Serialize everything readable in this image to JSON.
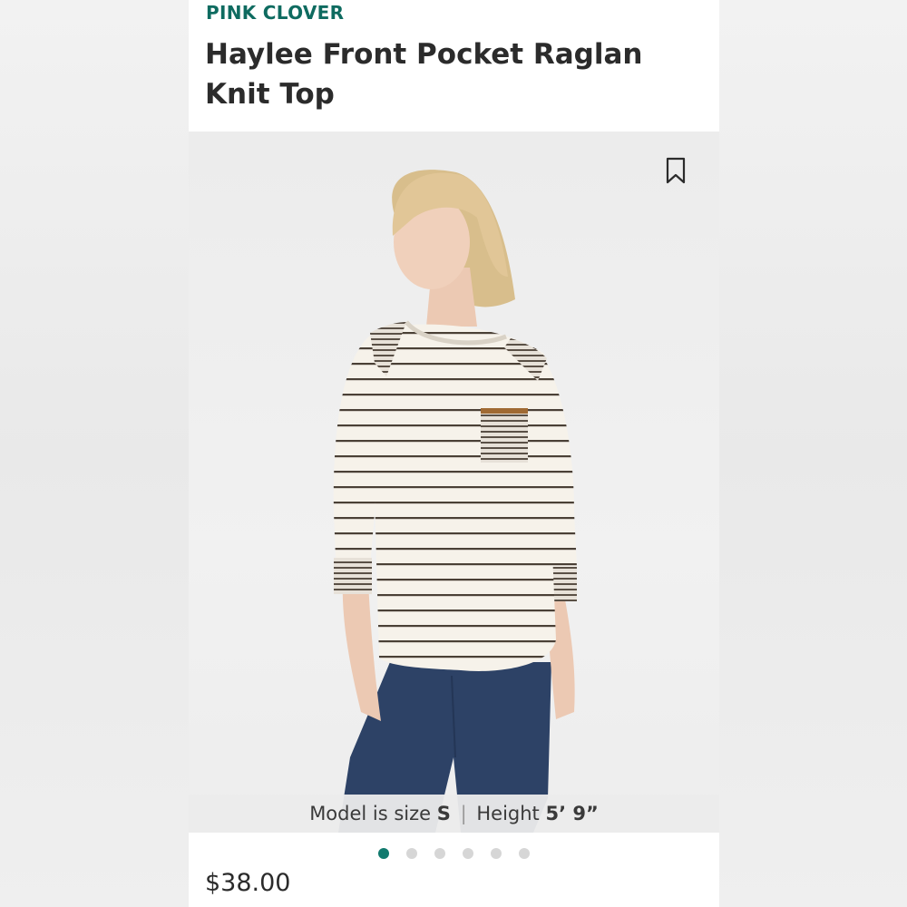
{
  "product": {
    "brand": "PINK CLOVER",
    "title": "Haylee Front Pocket Raglan Knit Top",
    "price": "$38.00"
  },
  "photo": {
    "model_label": "Model is size",
    "model_size": "S",
    "separator": "|",
    "height_label": "Height",
    "height_value": "5’ 9”"
  },
  "carousel": {
    "count": 6,
    "active_index": 0
  },
  "icons": {
    "bookmark": "bookmark-icon"
  },
  "colors": {
    "brand": "#0e6b60",
    "active_dot": "#117a6e",
    "inactive_dot": "#d6d6d6"
  }
}
